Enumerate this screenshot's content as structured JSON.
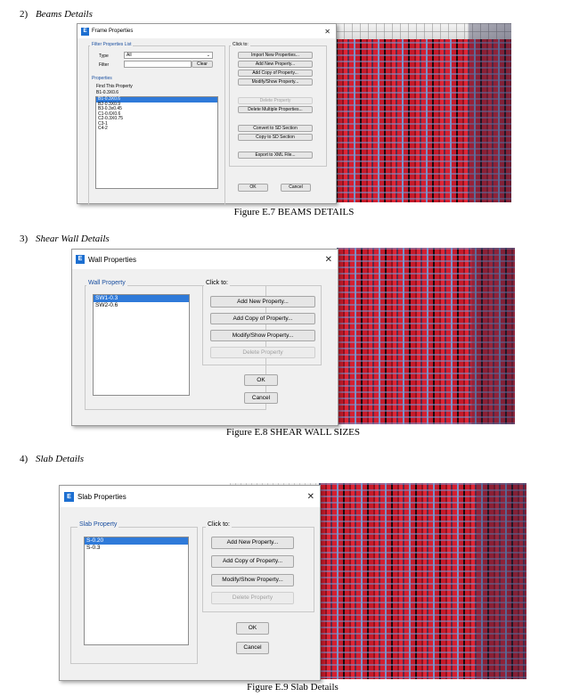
{
  "sections": [
    {
      "number": "2)",
      "title": "Beams Details",
      "caption": "Figure E.7 BEAMS DETAILS"
    },
    {
      "number": "3)",
      "title": "Shear Wall Details",
      "caption": "Figure E.8 SHEAR WALL SIZES"
    },
    {
      "number": "4)",
      "title": "Slab Details",
      "caption": "Figure E.9 Slab Details"
    }
  ],
  "frame_dialog": {
    "icon": "E",
    "title": "Frame Properties",
    "close": "✕",
    "filter_group": "Filter Properties List",
    "type_label": "Type",
    "type_value": "All",
    "filter_label": "Filter",
    "filter_value": "",
    "clear": "Clear",
    "properties_group": "Properties",
    "find_label": "Find This Property",
    "find_value": "B1-0.3X0.6",
    "items": [
      "B1-0.3X0.6",
      "B2-0.3X0.9",
      "B3-0.3x0.45",
      "C1-0.6X0.6",
      "C2-0.3X0.75",
      "C3-1",
      "C4-2"
    ],
    "selected_index": 0,
    "click_to": "Click to:",
    "buttons": [
      "Import New Properties...",
      "Add New Property...",
      "Add Copy of Property...",
      "Modify/Show Property...",
      "Delete Property",
      "Delete Multiple Properties...",
      "Convert to SD Section",
      "Copy to SD Section",
      "Export to XML File..."
    ],
    "ok": "OK",
    "cancel": "Cancel"
  },
  "wall_dialog": {
    "icon": "E",
    "title": "Wall Properties",
    "close": "✕",
    "group": "Wall Property",
    "items": [
      "SW1-0.3",
      "SW2-0.6"
    ],
    "selected_index": 0,
    "click_to": "Click to:",
    "buttons": [
      "Add New Property...",
      "Add Copy of Property...",
      "Modify/Show Property...",
      "Delete Property"
    ],
    "ok": "OK",
    "cancel": "Cancel"
  },
  "slab_dialog": {
    "icon": "E",
    "title": "Slab Properties",
    "close": "✕",
    "group": "Slab Property",
    "items": [
      "S-0.20",
      "S-0.3"
    ],
    "selected_index": 0,
    "click_to": "Click to:",
    "buttons": [
      "Add New Property...",
      "Add Copy of Property...",
      "Modify/Show Property...",
      "Delete Property"
    ],
    "ok": "OK",
    "cancel": "Cancel"
  },
  "colors": {
    "selection": "#2f7ad9",
    "group_label": "#1a4fa0",
    "icon": "#1d6fd1",
    "structure_red": "#c81a2a"
  }
}
